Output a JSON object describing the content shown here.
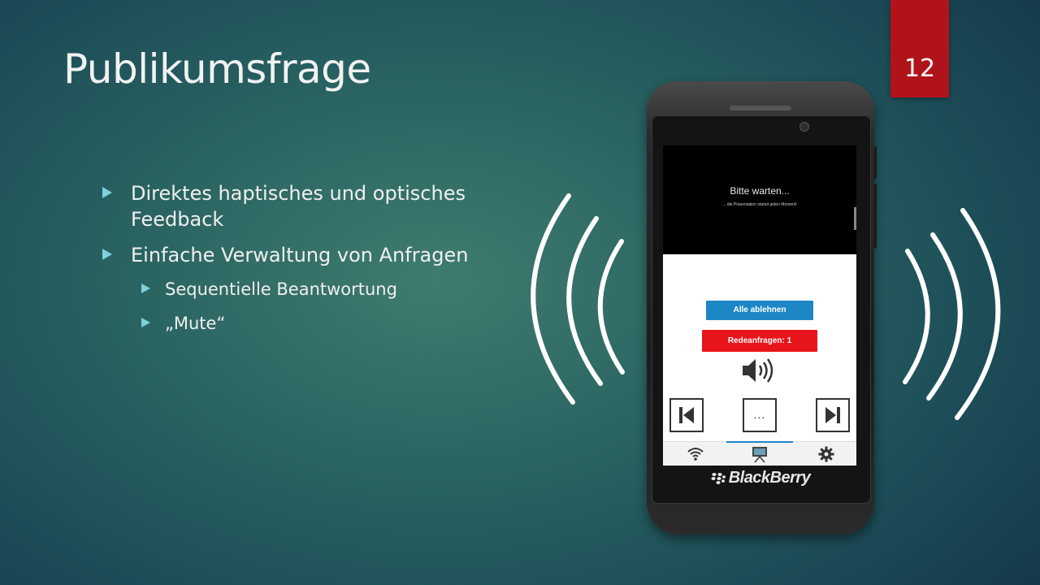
{
  "slide": {
    "title": "Publikumsfrage",
    "page_number": "12"
  },
  "bullets": [
    {
      "level": 1,
      "text": "Direktes haptisches und optisches Feedback"
    },
    {
      "level": 1,
      "text": "Einfache Verwaltung von Anfragen"
    },
    {
      "level": 2,
      "text": "Sequentielle Beantwortung"
    },
    {
      "level": 2,
      "text": "„Mute“"
    }
  ],
  "phone": {
    "brand": "BlackBerry",
    "screen": {
      "waiting_title": "Bitte warten...",
      "waiting_subtitle": "... die Präsentation startet jeden Moment!",
      "reject_all_label": "Alle ablehnen",
      "speech_requests_label": "Redeanfragen: 1",
      "more_button_label": "...",
      "colors": {
        "reject": "#1d87c6",
        "requests": "#e8141b"
      },
      "icons": [
        "speaker-volume-icon",
        "skip-previous-icon",
        "skip-next-icon",
        "wifi-icon",
        "presentation-icon",
        "gear-icon"
      ]
    }
  },
  "colors": {
    "accent_bullet": "#7ed0dc",
    "page_tab": "#b0141a"
  }
}
